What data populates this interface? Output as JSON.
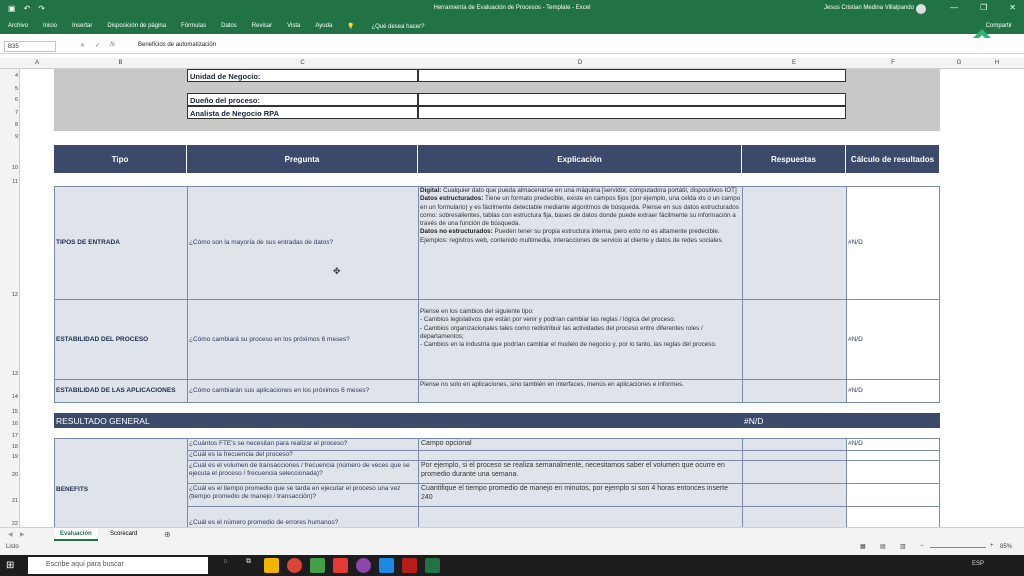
{
  "titlebar": {
    "title": "Herramienta de Evaluación de Procesos - Template - Excel",
    "user": "Jesus Cristian Medina Villalpando",
    "buttons": [
      "—",
      "❐",
      "✕"
    ]
  },
  "ribbon": {
    "tabs": [
      "Archivo",
      "Inicio",
      "Insertar",
      "Disposición de página",
      "Fórmulas",
      "Datos",
      "Revisar",
      "Vista",
      "Ayuda",
      "¿Qué desea hacer?"
    ],
    "share": "Compartir"
  },
  "formula_bar": {
    "name_box": "B35",
    "formula": "Beneficios de automatización"
  },
  "columns": [
    "A",
    "B",
    "C",
    "D",
    "E",
    "F",
    "G",
    "H"
  ],
  "rows": [
    "4",
    "5",
    "6",
    "7",
    "8",
    "9",
    "10",
    "11",
    "12",
    "13",
    "14",
    "15",
    "16",
    "17",
    "18",
    "19",
    "20",
    "21",
    "22"
  ],
  "info": {
    "unidad": "Unidad de Negocio:",
    "dueno": "Dueño del proceso:",
    "analista": "Analista de Negocio RPA"
  },
  "table_headers": {
    "tipo": "Tipo",
    "pregunta": "Pregunta",
    "explicacion": "Explicación",
    "respuestas": "Respuestas",
    "calculo": "Cálculo de resultados"
  },
  "rows_data": [
    {
      "tipo": "TIPOS DE ENTRADA",
      "pregunta": "¿Cómo son la mayoría de sus entradas de datos?",
      "explicacion_parts": [
        {
          "b": "Digital:",
          "t": " Cualquier dato que pueda almacenarse en una máquina [servidor, computadora portátil, dispositivos IOT]"
        },
        {
          "b": "Datos estructurados:",
          "t": " Tiene un formato predecible, existe en campos fijos (por ejemplo, una celda xls o un campo en un formulario) y es fácilmente detectable mediante algoritmos de búsqueda. Piense en sus datos estructurados como: sobresalientes, tablas con estructura fija, bases de datos donde puede extraer fácilmente su información a través de una función de búsqueda."
        },
        {
          "b": "Datos no estructurados:",
          "t": " Pueden tener su propia estructura interna, pero esto no es altamente predecible. Ejemplos: registros web, contenido multimedia, interacciones de servicio al cliente y datos de redes sociales."
        }
      ],
      "calculo": "#N/D"
    },
    {
      "tipo": "ESTABILIDAD DEL PROCESO",
      "pregunta": "¿Cómo cambiará su proceso en los próximos 6 meses?",
      "explicacion_lines": [
        "Piense en los cambios del siguiente tipo:",
        "- Cambios legislativos que están por venir y podrían cambiar las reglas / lógica del proceso.",
        "- Cambios organizacionales tales como redistribuir las actividades del proceso entre diferentes roles / departamentos;",
        "- Cambios en la industria que podrían cambiar el modelo de negocio y, por lo tanto, las reglas del proceso."
      ],
      "calculo": "#N/D"
    },
    {
      "tipo": "ESTABILIDAD DE LAS APLICACIONES",
      "pregunta": "¿Cómo cambiarán sus aplicaciones en los próximos 6 meses?",
      "explicacion": "Piense no solo en aplicaciones, sino también en interfaces, menús en aplicaciones e informes.",
      "calculo": "#N/D"
    }
  ],
  "resultado_general": {
    "label": "RESULTADO GENERAL",
    "value": "#N/D"
  },
  "benefits": {
    "tipo": "BENEFITS",
    "items": [
      {
        "pregunta": "¿Cuántos FTE's se necesitan para realizar el proceso?",
        "explicacion": "Campo opcional",
        "calculo": "#N/D"
      },
      {
        "pregunta": "¿Cuál es la frecuencia del proceso?",
        "explicacion": "",
        "calculo": ""
      },
      {
        "pregunta": "¿Cuál es el volumen de transacciones / frecuencia (número de veces que se ejecuta el proceso / frecuencia seleccionada)?",
        "explicacion": "Por ejemplo, si el proceso se realiza semanalmente, necesitamos saber el volumen que ocurre en promedio durante una semana.",
        "calculo": ""
      },
      {
        "pregunta": "¿Cuál es el tiempo promedio que se tarda en ejecutar el proceso una vez (tiempo promedio de manejo / transacción)?",
        "explicacion": "Cuantifique el tiempo promedio de manejo en minutos, por ejemplo si son 4 horas entonces inserte 240",
        "calculo": ""
      },
      {
        "pregunta": "¿Cuál es el número promedio de errores humanos?",
        "explicacion": "",
        "calculo": ""
      }
    ]
  },
  "sheet_tabs": [
    "Evaluación",
    "Scorecard"
  ],
  "status": {
    "left": "Listo",
    "zoom": "85%"
  },
  "taskbar": {
    "search_placeholder": "Escribe aquí para buscar",
    "lang": "ESP"
  },
  "colors": {
    "excel_green": "#217346",
    "header_navy": "#3b4a6b",
    "row_fill": "#dfe3ea"
  }
}
